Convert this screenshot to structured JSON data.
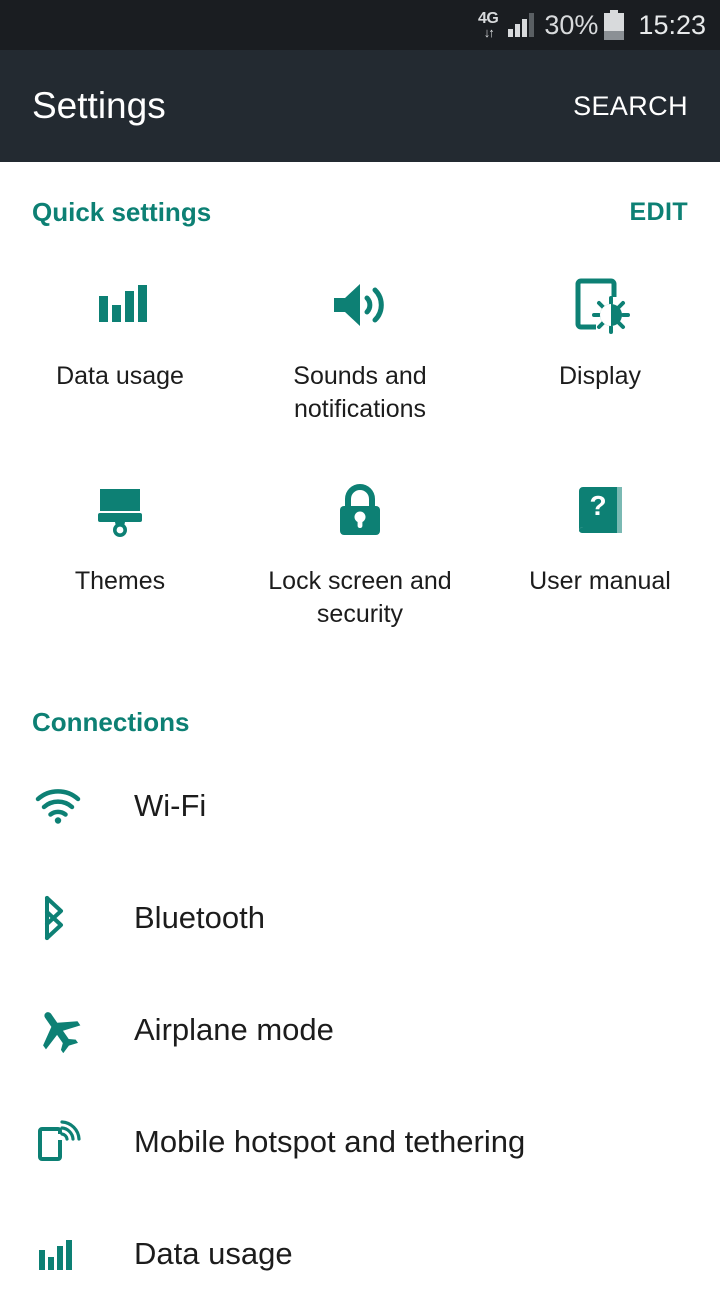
{
  "theme": {
    "accent": "#0d8074",
    "status_bar_bg": "#1a1d21",
    "app_bar_bg": "#232a31",
    "page_bg": "#ffffff"
  },
  "status_bar": {
    "network_type": "4G",
    "data_arrows": "↓↑",
    "signal_bars_total": 4,
    "signal_bars_active": 3,
    "battery_percent": "30%",
    "battery_level": 30,
    "time": "15:23"
  },
  "app_bar": {
    "title": "Settings",
    "search_label": "SEARCH"
  },
  "quick_settings": {
    "title": "Quick settings",
    "edit_label": "EDIT",
    "tiles": [
      {
        "label": "Data usage",
        "icon": "data-usage-icon"
      },
      {
        "label": "Sounds and notifications",
        "icon": "volume-icon"
      },
      {
        "label": "Display",
        "icon": "display-brightness-icon"
      },
      {
        "label": "Themes",
        "icon": "paint-brush-icon"
      },
      {
        "label": "Lock screen and security",
        "icon": "lock-icon"
      },
      {
        "label": "User manual",
        "icon": "book-question-icon"
      }
    ]
  },
  "connections": {
    "title": "Connections",
    "items": [
      {
        "label": "Wi-Fi",
        "icon": "wifi-icon"
      },
      {
        "label": "Bluetooth",
        "icon": "bluetooth-icon"
      },
      {
        "label": "Airplane mode",
        "icon": "airplane-icon"
      },
      {
        "label": "Mobile hotspot and tethering",
        "icon": "mobile-hotspot-icon"
      },
      {
        "label": "Data usage",
        "icon": "data-usage-icon"
      }
    ]
  }
}
